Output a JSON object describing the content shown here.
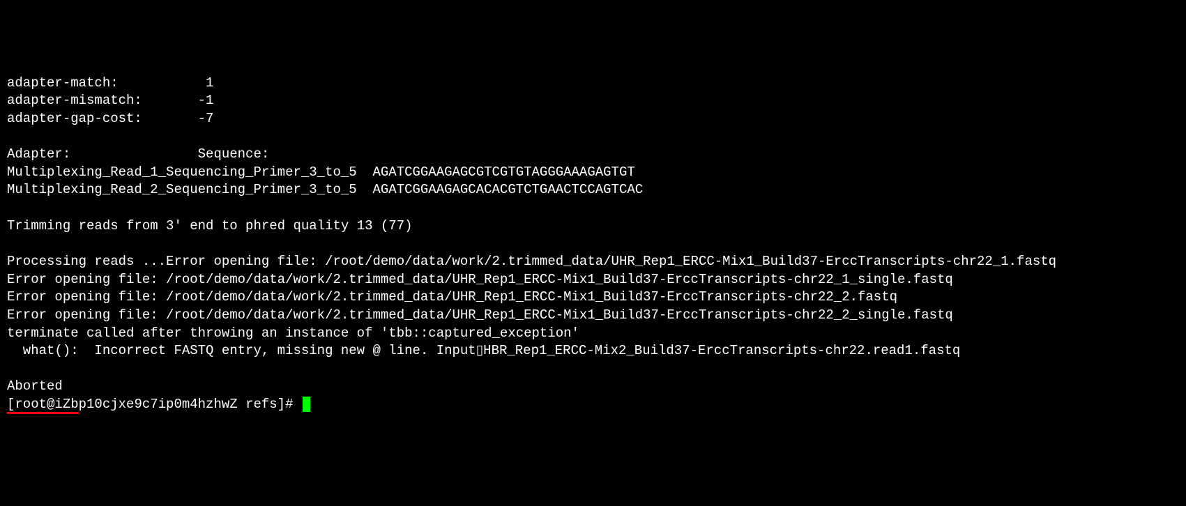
{
  "terminal": {
    "lines": {
      "l1": "adapter-match:           1",
      "l2": "adapter-mismatch:       -1",
      "l3": "adapter-gap-cost:       -7",
      "l4": "",
      "l5": "Adapter:                Sequence:",
      "l6": "Multiplexing_Read_1_Sequencing_Primer_3_to_5  AGATCGGAAGAGCGTCGTGTAGGGAAAGAGTGT",
      "l7": "Multiplexing_Read_2_Sequencing_Primer_3_to_5  AGATCGGAAGAGCACACGTCTGAACTCCAGTCAC",
      "l8": "",
      "l9": "Trimming reads from 3' end to phred quality 13 (77)",
      "l10": "",
      "l11": "Processing reads ...Error opening file: /root/demo/data/work/2.trimmed_data/UHR_Rep1_ERCC-Mix1_Build37-ErccTranscripts-chr22_1.fastq",
      "l12": "Error opening file: /root/demo/data/work/2.trimmed_data/UHR_Rep1_ERCC-Mix1_Build37-ErccTranscripts-chr22_1_single.fastq",
      "l13": "Error opening file: /root/demo/data/work/2.trimmed_data/UHR_Rep1_ERCC-Mix1_Build37-ErccTranscripts-chr22_2.fastq",
      "l14": "Error opening file: /root/demo/data/work/2.trimmed_data/UHR_Rep1_ERCC-Mix1_Build37-ErccTranscripts-chr22_2_single.fastq",
      "l15": "terminate called after throwing an instance of 'tbb::captured_exception'",
      "l16": "  what():  Incorrect FASTQ entry, missing new @ line. Input▯HBR_Rep1_ERCC-Mix2_Build37-ErccTranscripts-chr22.read1.fastq",
      "l17": "",
      "l18": "Aborted"
    },
    "prompt": {
      "underlined": "[root@iZb",
      "rest": "p10cjxe9c7ip0m4hzhwZ refs]# "
    }
  }
}
